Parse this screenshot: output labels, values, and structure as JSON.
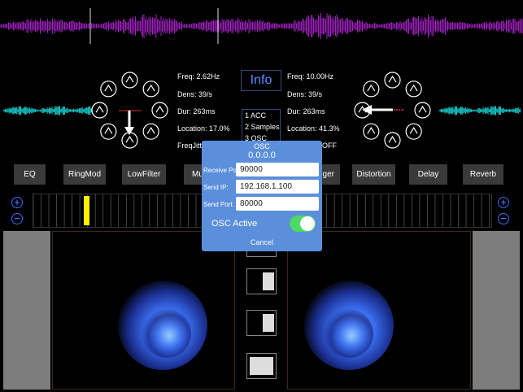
{
  "colors": {
    "waveform_top": "#a020c0",
    "waveform_side": "#18c8c8",
    "accent": "#3b6dff",
    "toggle_on": "#4cd964",
    "dialog_bg": "#5b8fdc",
    "seq_marker": "#ffee00"
  },
  "left_readouts": [
    "Freq: 2.62Hz",
    "Dens: 39/s",
    "Dur: 263ms",
    "Location: 17.0%",
    "FreqJitt"
  ],
  "right_readouts": [
    "Freq: 10.00Hz",
    "Dens: 39/s",
    "Dur: 263ms",
    "Location: 41.3%",
    "OFF"
  ],
  "info_label": "Info",
  "mode_list": [
    "1 ACC",
    "2 Samples",
    "3 OSC"
  ],
  "effects": [
    "EQ",
    "RingMod",
    "LowFilter",
    "Mu",
    "nger",
    "Distortion",
    "Delay",
    "Reverb"
  ],
  "plus_label": "+",
  "minus_label": "−",
  "osc_dialog": {
    "title": "OSC",
    "address": "0.0.0.0",
    "receive_port_label": "Receive Port:",
    "receive_port_value": "90000",
    "send_ip_label": "Send IP:",
    "send_ip_value": "192.168.1.100",
    "send_port_label": "Send Port:",
    "send_port_value": "80000",
    "osc_active_label": "OSC Active",
    "osc_active": true,
    "cancel_label": "Cancel"
  }
}
